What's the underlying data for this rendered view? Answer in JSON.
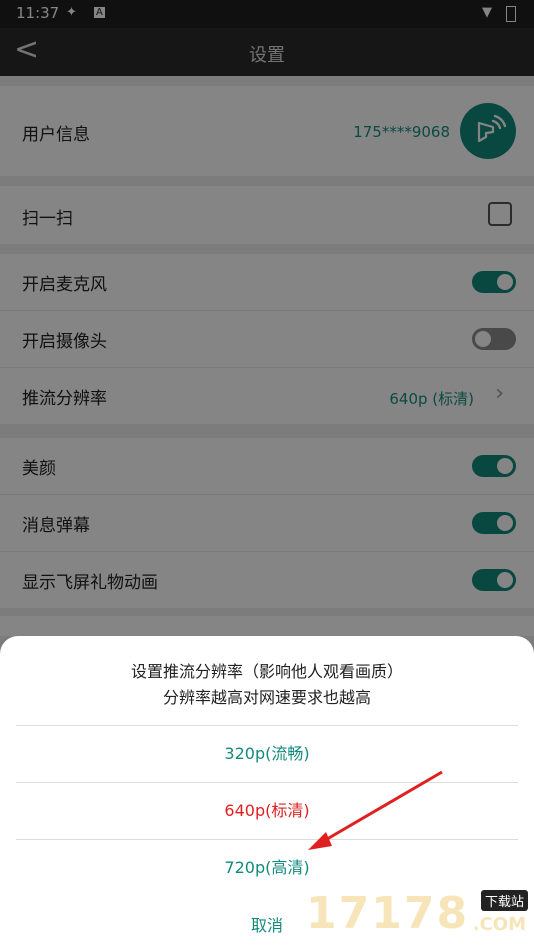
{
  "status_bar": {
    "time": "11:37"
  },
  "header": {
    "title": "设置",
    "back_glyph": "<"
  },
  "settings": {
    "user_info": {
      "label": "用户信息",
      "value": "175****9068"
    },
    "scan": {
      "label": "扫一扫"
    },
    "microphone": {
      "label": "开启麦克风",
      "enabled": true
    },
    "camera": {
      "label": "开启摄像头",
      "enabled": false
    },
    "resolution": {
      "label": "推流分辨率",
      "value": "640p (标清)"
    },
    "beauty": {
      "label": "美颜",
      "enabled": true
    },
    "danmaku": {
      "label": "消息弹幕",
      "enabled": true
    },
    "gift_animation": {
      "label": "显示飞屏礼物动画",
      "enabled": true
    }
  },
  "dialog": {
    "title_line1": "设置推流分辨率（影响他人观看画质）",
    "title_line2": "分辨率越高对网速要求也越高",
    "options": [
      "320p(流畅)",
      "640p(标清)",
      "720p(高清)"
    ],
    "selected": "640p(标清)",
    "cancel": "取消"
  },
  "watermark": {
    "numbers": "17178",
    "tag": "下载站",
    "domain": ".COM"
  },
  "colors": {
    "accent": "#138a7c",
    "selected": "#e02020",
    "annotation_arrow": "#e02020"
  }
}
